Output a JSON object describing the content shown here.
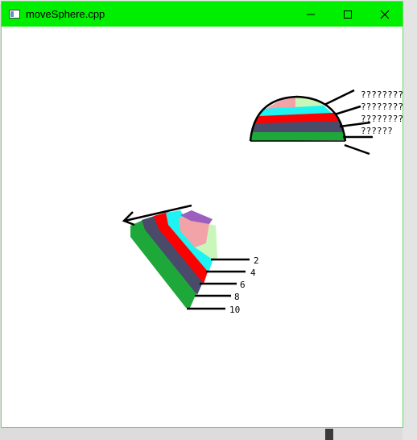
{
  "window": {
    "title": "moveSphere.cpp",
    "title_bar_color": "#00ee00",
    "border_color": "#6fd66f",
    "controls": {
      "minimize_icon": "minimize-icon",
      "maximize_icon": "maximize-icon",
      "close_icon": "close-icon"
    }
  },
  "scene": {
    "hemisphere": {
      "band_colors": [
        "#f2a3a8",
        "#c9f7b9",
        "#1ff2f2",
        "#ff0000",
        "#4a4a6a",
        "#1fa83a"
      ],
      "labels": [
        "????????",
        "????????",
        "????????",
        "??????"
      ]
    },
    "tilted_sphere": {
      "band_colors": [
        "#9a5fbf",
        "#f2a3a8",
        "#c9f7b9",
        "#1ff2f2",
        "#ff0000",
        "#4a4a6a",
        "#1fa83a"
      ],
      "labels": [
        "2",
        "4",
        "6",
        "8",
        "10"
      ]
    }
  }
}
